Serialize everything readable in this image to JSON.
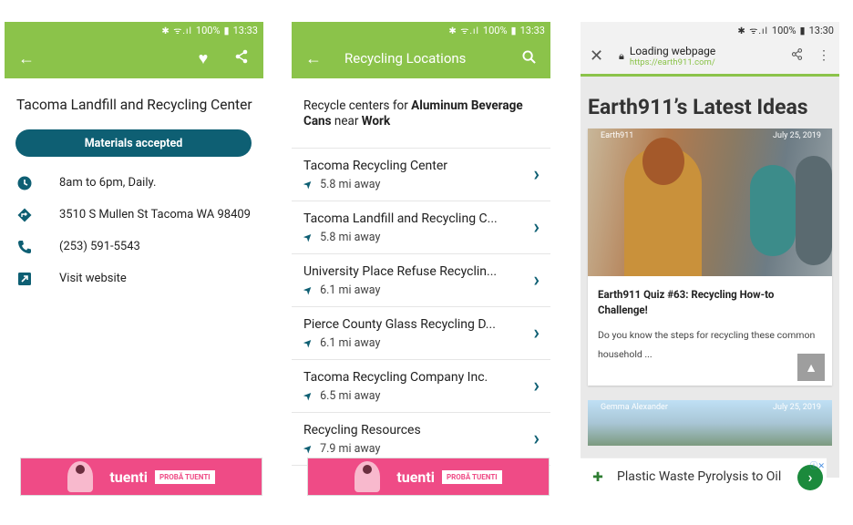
{
  "screen1": {
    "status": {
      "battery": "100%",
      "time": "13:33",
      "icons": "✱ ᯤ.ıl"
    },
    "title": "Tacoma Landfill and Recycling Center",
    "materials_button": "Materials accepted",
    "hours": "8am to 6pm, Daily.",
    "address": "3510 S Mullen St Tacoma WA 98409",
    "phone": "(253) 591-5543",
    "website": "Visit website",
    "ad": {
      "brand": "tuenti",
      "cta": "PROBĂ TUENTI"
    }
  },
  "screen2": {
    "status": {
      "battery": "100%",
      "time": "13:33",
      "icons": "✱ ᯤ.ıl"
    },
    "title": "Recycling Locations",
    "query_prefix": "Recycle centers for ",
    "query_material": "Aluminum Beverage Cans",
    "query_mid": " near ",
    "query_place": "Work",
    "locations": [
      {
        "name": "Tacoma Recycling Center",
        "distance": "5.8 mi away"
      },
      {
        "name": "Tacoma Landfill and Recycling C...",
        "distance": "5.8 mi away"
      },
      {
        "name": "University Place Refuse Recyclin...",
        "distance": "6.1 mi away"
      },
      {
        "name": "Pierce County Glass Recycling D...",
        "distance": "6.1 mi away"
      },
      {
        "name": "Tacoma Recycling Company Inc.",
        "distance": "6.5 mi away"
      },
      {
        "name": "Recycling Resources",
        "distance": "7.9 mi away"
      }
    ],
    "ad": {
      "brand": "tuenti",
      "cta": "PROBĂ TUENTI"
    }
  },
  "screen3": {
    "status": {
      "battery": "100%",
      "time": "13:30",
      "icons": "✱ ᯤ.ıl"
    },
    "browser_title": "Loading webpage",
    "browser_url": "https://earth911.com/",
    "headline": "Earth911’s Latest Ideas",
    "card1": {
      "tag": "Earth911",
      "date": "July 25, 2019",
      "title": "Earth911 Quiz #63: Recycling How-to Challenge!",
      "excerpt": "Do you know the steps for recycling these common household ..."
    },
    "card2": {
      "tag": "Gemma Alexander",
      "date": "July 25, 2019"
    },
    "ad": {
      "text": "Plastic Waste Pyrolysis to Oil"
    }
  }
}
